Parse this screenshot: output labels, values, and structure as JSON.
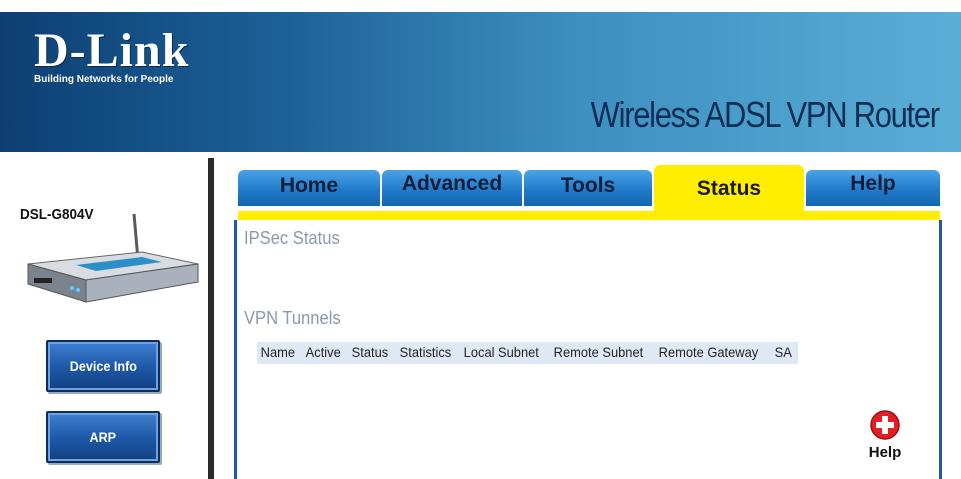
{
  "brand": {
    "name": "D-Link",
    "tagline": "Building Networks for People"
  },
  "product": {
    "title": "Wireless ADSL VPN Router",
    "model": "DSL-G804V"
  },
  "sidebar": {
    "buttons": [
      {
        "label": "Device Info"
      },
      {
        "label": "ARP"
      }
    ]
  },
  "tabs": [
    {
      "label": "Home",
      "active": false
    },
    {
      "label": "Advanced",
      "active": false
    },
    {
      "label": "Tools",
      "active": false
    },
    {
      "label": "Status",
      "active": true
    },
    {
      "label": "Help",
      "active": false
    }
  ],
  "main": {
    "ipsec_title": "IPSec  Status",
    "vpn_title": "VPN Tunnels",
    "vpn_columns": [
      "Name",
      "Active",
      "Status",
      "Statistics",
      "Local Subnet",
      "Remote Subnet",
      "Remote Gateway",
      "SA"
    ],
    "help_label": "Help"
  },
  "colors": {
    "banner_dark": "#0d3f72",
    "banner_light": "#5aaed6",
    "tab_blue": "#1e78c8",
    "tab_active": "#ffee00",
    "section_title": "#8a9aaa",
    "table_header_bg": "#dfe9f5",
    "help_icon": "#e31e24"
  },
  "icons": {
    "help": "plus-in-red-circle-icon",
    "device": "router-device-image"
  }
}
